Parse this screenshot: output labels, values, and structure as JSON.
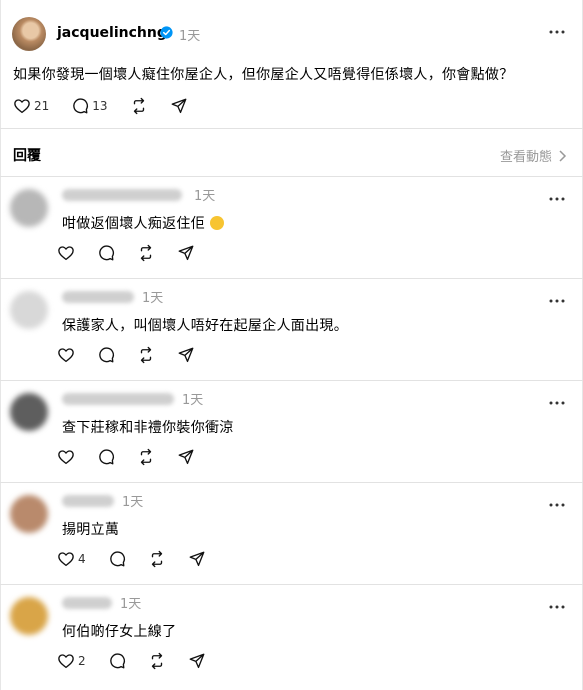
{
  "post": {
    "username": "jacquelinchng",
    "time": "1天",
    "text": "如果你發現一個壞人癡住你屋企人，但你屋企人又唔覺得佢係壞人，你會點做？",
    "likes": "21",
    "comments": "13"
  },
  "replies_header": {
    "label": "回覆",
    "view_activity": "查看動態"
  },
  "comments": [
    {
      "time": "1天",
      "text": "咁做返個壞人痴返住佢",
      "likes": "",
      "avatar_color": "#b7b7b7"
    },
    {
      "time": "1天",
      "text": "保護家人，叫個壞人唔好在起屋企人面出現。",
      "likes": "",
      "avatar_color": "#d8d8d8"
    },
    {
      "time": "1天",
      "text": "查下莊稼和非禮你裝你衝涼",
      "likes": "",
      "avatar_color": "#5e5e5e"
    },
    {
      "time": "1天",
      "text": "揚明立萬",
      "likes": "4",
      "avatar_color": "#b98a6c"
    },
    {
      "time": "1天",
      "text": "何伯啲仔女上線了",
      "likes": "2",
      "avatar_color": "#d9a548"
    }
  ],
  "icons": {
    "verified": "verified-badge-icon",
    "like": "heart-icon",
    "comment": "comment-icon",
    "repost": "repost-icon",
    "share": "share-icon",
    "more": "more-icon",
    "chevron": "chevron-right-icon"
  },
  "colors": {
    "verified": "#0095f6",
    "muted": "#999999",
    "divider": "#e2e2e2"
  }
}
